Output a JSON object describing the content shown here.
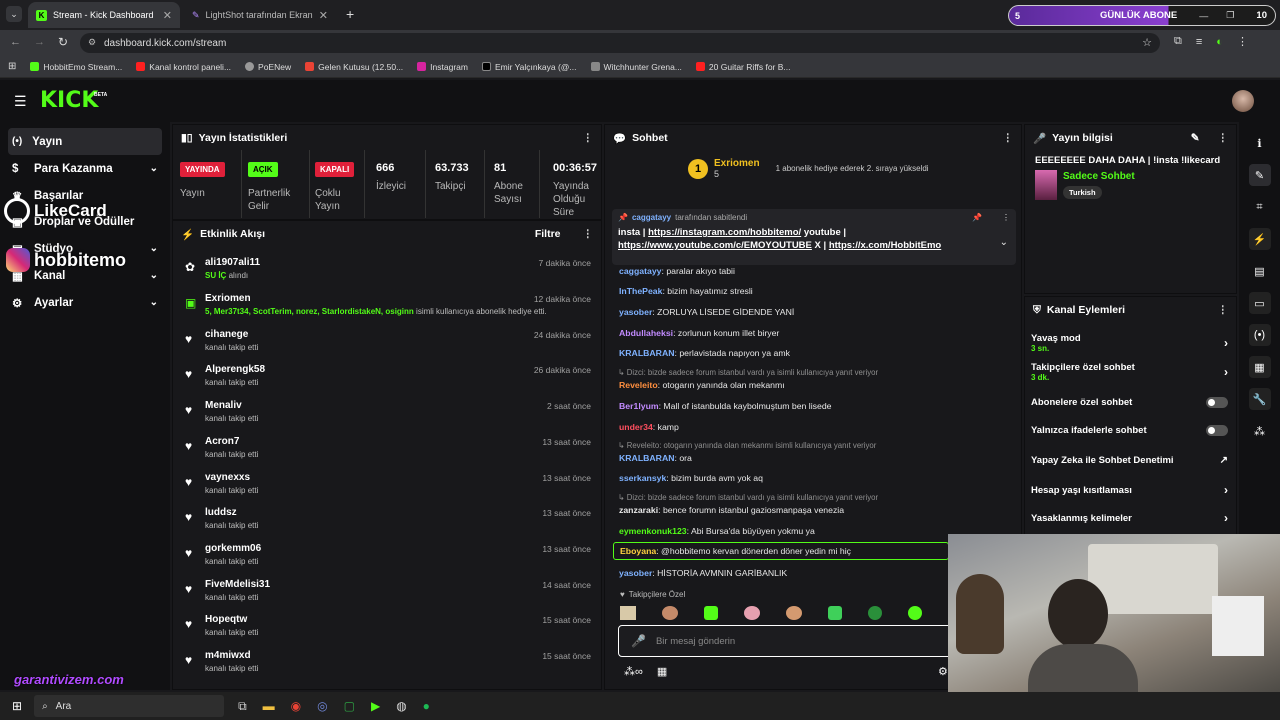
{
  "browser": {
    "tabs": [
      {
        "label": "Stream - Kick Dashboard",
        "active": true
      },
      {
        "label": "LightShot tarafından Ekran Gör...",
        "active": false
      }
    ],
    "url": "dashboard.kick.com/stream",
    "bookmarks": [
      "HobbitEmo Stream...",
      "Kanal kontrol paneli...",
      "PoENew",
      "Gelen Kutusu (12.50...",
      "Instagram",
      "Emir Yalçınkaya (@...",
      "Witchhunter Grena...",
      "20 Guitar Riffs for B..."
    ],
    "sub_banner": {
      "count": "5",
      "label": "GÜNLÜK ABONE",
      "value": "10"
    }
  },
  "kick": {
    "logo": "KICK",
    "logo_beta": "BETA",
    "sidebar": [
      {
        "label": "Yayın",
        "selected": true
      },
      {
        "label": "Para Kazanma"
      },
      {
        "label": "Başarılar"
      },
      {
        "label": "Droplar ve Ödüller"
      },
      {
        "label": "Stüdyo"
      },
      {
        "label": "Kanal"
      },
      {
        "label": "Ayarlar"
      }
    ],
    "overlay": {
      "likecard": "LikeCard",
      "instagram": "hobbitemo",
      "garanti": "garantivizem.com"
    }
  },
  "stats": {
    "title": "Yayın İstatistikleri",
    "items": [
      {
        "badge": "YAYINDA",
        "label": "Yayın",
        "color": "#e0203a"
      },
      {
        "badge": "AÇIK",
        "label": "Partnerlik Gelir",
        "color": "#53fc18"
      },
      {
        "badge": "KAPALI",
        "label": "Çoklu Yayın",
        "color": "#e0203a"
      },
      {
        "value": "666",
        "label": "İzleyici"
      },
      {
        "value": "63.733",
        "label": "Takipçi"
      },
      {
        "value": "81",
        "label": "Abone Sayısı"
      },
      {
        "value": "00:36:57",
        "label": "Yayında Olduğu Süre"
      }
    ]
  },
  "activity": {
    "title": "Etkinlik Akışı",
    "filter": "Filtre",
    "events": [
      {
        "name": "ali1907ali11",
        "sub": "SU İÇ alındı",
        "time": "7 dakika önce",
        "type": "redeem"
      },
      {
        "name": "Exriomen",
        "sub_highlight": "5, Mer37t34, ScotTerim, norez, StarlordistakeN, osiginn",
        "sub": "isimli kullanıcıya abonelik hediye etti.",
        "time": "12 dakika önce",
        "type": "gift"
      },
      {
        "name": "cihanege",
        "sub": "kanalı takip etti",
        "time": "24 dakika önce",
        "type": "follow"
      },
      {
        "name": "Alperengk58",
        "sub": "kanalı takip etti",
        "time": "26 dakika önce",
        "type": "follow"
      },
      {
        "name": "Menaliv",
        "sub": "kanalı takip etti",
        "time": "2 saat önce",
        "type": "follow"
      },
      {
        "name": "Acron7",
        "sub": "kanalı takip etti",
        "time": "13 saat önce",
        "type": "follow"
      },
      {
        "name": "vaynexxs",
        "sub": "kanalı takip etti",
        "time": "13 saat önce",
        "type": "follow"
      },
      {
        "name": "luddsz",
        "sub": "kanalı takip etti",
        "time": "13 saat önce",
        "type": "follow"
      },
      {
        "name": "gorkemm06",
        "sub": "kanalı takip etti",
        "time": "13 saat önce",
        "type": "follow"
      },
      {
        "name": "FiveMdelisi31",
        "sub": "kanalı takip etti",
        "time": "14 saat önce",
        "type": "follow"
      },
      {
        "name": "Hopeqtw",
        "sub": "kanalı takip etti",
        "time": "15 saat önce",
        "type": "follow"
      },
      {
        "name": "m4miwxd",
        "sub": "kanalı takip etti",
        "time": "15 saat önce",
        "type": "follow"
      }
    ]
  },
  "chat": {
    "title": "Sohbet",
    "top_gifter": {
      "name": "Exriomen",
      "count": "5",
      "note": "1 abonelik hediye ederek 2. sıraya yükseldi"
    },
    "pinned": {
      "user": "caggatayy",
      "by": "tarafından sabitlendi",
      "text1": "insta | ",
      "link1": "https://instagram.com/hobbitemo/",
      "text2": " youtube |",
      "link2": "https://www.youtube.com/c/EMOYOUTUBE",
      "text3": " X | ",
      "link3": "https://x.com/HobbitEmo"
    },
    "messages": [
      {
        "user": "caggatayy",
        "color": "#7fb2ff",
        "text": ": paralar akıyo tabii"
      },
      {
        "user": "InThePeak",
        "color": "#7fb2ff",
        "text": ": bizim hayatımız stresli"
      },
      {
        "user": "yasober",
        "color": "#7fb2ff",
        "text": ": ZORLUYA LİSEDE GİDENDE YANİ"
      },
      {
        "user": "Abdullaheksi",
        "color": "#c28bff",
        "text": ": zorlunun konum illet biryer"
      },
      {
        "user": "KRALBARAN",
        "color": "#7fb2ff",
        "text": ": perlavistada napıyon ya amk"
      },
      {
        "reply": "Dizci: bizde sadece forum istanbul vardı ya isimli kullanıcıya yanıt veriyor"
      },
      {
        "user": "Reveleito",
        "color": "#ff8f3f",
        "text": ": otogarın yanında olan mekanmı"
      },
      {
        "user": "Ber1lyum",
        "color": "#c28bff",
        "text": ": Mall of istanbulda kaybolmuştum ben lisede"
      },
      {
        "user": "under34",
        "color": "#ff4f5f",
        "text": ": kamp"
      },
      {
        "reply": "Reveleito: otogarın yanında olan mekanmı isimli kullanıcıya yanıt veriyor"
      },
      {
        "user": "KRALBARAN",
        "color": "#7fb2ff",
        "text": ": ora"
      },
      {
        "user": "sserkansyk",
        "color": "#7fb2ff",
        "text": ": bizim burda avm yok aq"
      },
      {
        "reply": "Dizci: bizde sadece forum istanbul vardı ya isimli kullanıcıya yanıt veriyor"
      },
      {
        "user": "zanzaraki",
        "color": "#e8e8e8",
        "text": ": bence forumn istanbul gaziosmanpaşa venezia"
      },
      {
        "user": "eymenkonuk123",
        "color": "#53fc18",
        "text": ": Abi Bursa'da büyüyen yokmu ya"
      },
      {
        "user": "Eboyana",
        "color": "#ffd23f",
        "text": ": @hobbitemo kervan dönerden döner yedin mi hiç",
        "highlight": true
      },
      {
        "user": "yasober",
        "color": "#7fb2ff",
        "text": ": HİSTORİA AVMNIN GARİBANLIK"
      }
    ],
    "followers_only": "Takipçilere Özel",
    "input_placeholder": "Bir mesaj gönderin"
  },
  "stream_info": {
    "title": "Yayın bilgisi",
    "stream_title": "EEEEEEEE DAHA DAHA | !insta !likecard",
    "category": "Sadece Sohbet",
    "tag": "Turkish"
  },
  "channel_actions": {
    "title": "Kanal Eylemleri",
    "items": [
      {
        "label": "Yavaş mod",
        "sub": "3 sn.",
        "control": "arrow"
      },
      {
        "label": "Takipçilere özel sohbet",
        "sub": "3 dk.",
        "control": "arrow"
      },
      {
        "label": "Abonelere özel sohbet",
        "control": "toggle"
      },
      {
        "label": "Yalnızca ifadelerle sohbet",
        "control": "toggle"
      },
      {
        "label": "Yapay Zeka ile Sohbet Denetimi",
        "control": "external"
      },
      {
        "label": "Hesap yaşı kısıtlaması",
        "control": "arrow"
      },
      {
        "label": "Yasaklanmış kelimeler",
        "control": "arrow"
      }
    ]
  },
  "taskbar": {
    "search": "Ara"
  }
}
